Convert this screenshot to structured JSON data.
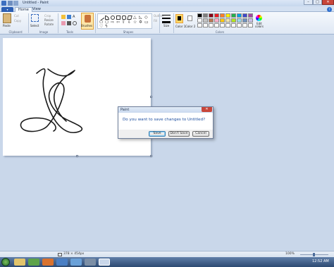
{
  "window": {
    "title": "Untitled - Paint",
    "minimize_glyph": "–",
    "maximize_glyph": "□",
    "close_glyph": "✕"
  },
  "ribbon": {
    "menu_label": "▾",
    "tabs": [
      "Home",
      "View"
    ],
    "help_glyph": "?",
    "clipboard": {
      "paste": "Paste",
      "cut": "Cut",
      "copy": "Copy",
      "group": "Clipboard"
    },
    "image": {
      "select": "Select",
      "crop": "Crop",
      "resize": "Resize",
      "rotate": "Rotate",
      "group": "Image"
    },
    "tools": {
      "group": "Tools"
    },
    "brushes": {
      "label": "Brushes"
    },
    "shapes": {
      "outline": "Outline",
      "fill": "Fill",
      "group": "Shapes"
    },
    "size": {
      "label": "Size"
    },
    "colors": {
      "color1": "Color 1",
      "color2": "Color 2",
      "edit": "Edit colors",
      "group": "Colors",
      "swatches_row1": [
        "#000000",
        "#7f7f7f",
        "#880015",
        "#ed1c24",
        "#ff7f27",
        "#fff200",
        "#22b14c",
        "#00a2e8",
        "#3f48cc",
        "#a349a4"
      ],
      "swatches_row2": [
        "#ffffff",
        "#c3c3c3",
        "#b97a57",
        "#ffaec9",
        "#ffc90e",
        "#efe4b0",
        "#b5e61d",
        "#99d9ea",
        "#7092be",
        "#c8bfe7"
      ],
      "swatches_row3": [
        "#ffffff",
        "#ffffff",
        "#ffffff",
        "#ffffff",
        "#ffffff",
        "#ffffff",
        "#ffffff",
        "#ffffff",
        "#ffffff",
        "#ffffff"
      ]
    }
  },
  "dialog": {
    "title": "Paint",
    "close_glyph": "✕",
    "message": "Do you want to save changes to Untitled?",
    "buttons": {
      "save": "Save",
      "dont_save": "Don't Save",
      "cancel": "Cancel"
    }
  },
  "status": {
    "canvas_size": "378 × 454px",
    "zoom": "100%"
  },
  "taskbar": {
    "clock": "12:52 AM"
  }
}
